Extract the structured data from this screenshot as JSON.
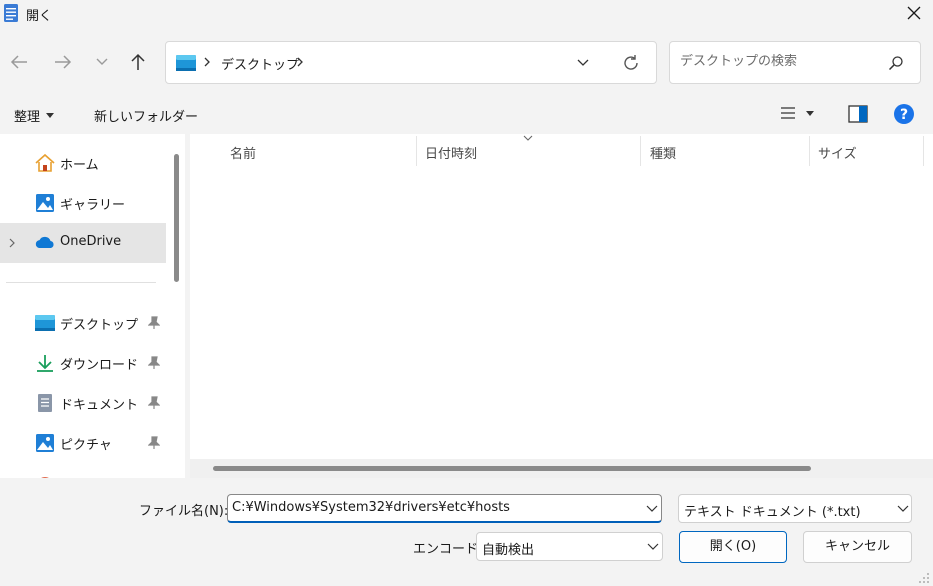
{
  "window": {
    "title": "開く"
  },
  "address": {
    "crumbs": [
      "デスクトップ"
    ]
  },
  "search": {
    "placeholder": "デスクトップの検索"
  },
  "toolbar": {
    "organize_label": "整理",
    "new_folder_label": "新しいフォルダー"
  },
  "nav": {
    "items": [
      {
        "label": "ホーム",
        "icon": "home-icon"
      },
      {
        "label": "ギャラリー",
        "icon": "gallery-icon"
      },
      {
        "label": "OneDrive",
        "icon": "onedrive-icon",
        "selected": true
      },
      {
        "label": "デスクトップ",
        "icon": "desktop-folder-icon",
        "pinned": true
      },
      {
        "label": "ダウンロード",
        "icon": "download-icon",
        "pinned": true
      },
      {
        "label": "ドキュメント",
        "icon": "document-icon",
        "pinned": true
      },
      {
        "label": "ピクチャ",
        "icon": "pictures-icon",
        "pinned": true
      }
    ]
  },
  "columns": [
    "名前",
    "日付時刻",
    "種類",
    "サイズ"
  ],
  "footer": {
    "filename_label": "ファイル名(N):",
    "filename_value": "C:¥Windows¥System32¥drivers¥etc¥hosts",
    "filetype_value": "テキスト ドキュメント (*.txt)",
    "encoding_label": "エンコード:",
    "encoding_value": "自動検出",
    "open_label": "開く(O)",
    "cancel_label": "キャンセル"
  },
  "colors": {
    "accent": "#0067c0",
    "help": "#1a73e8",
    "onedrive": "#0f78d4",
    "home": "#e8a030"
  }
}
